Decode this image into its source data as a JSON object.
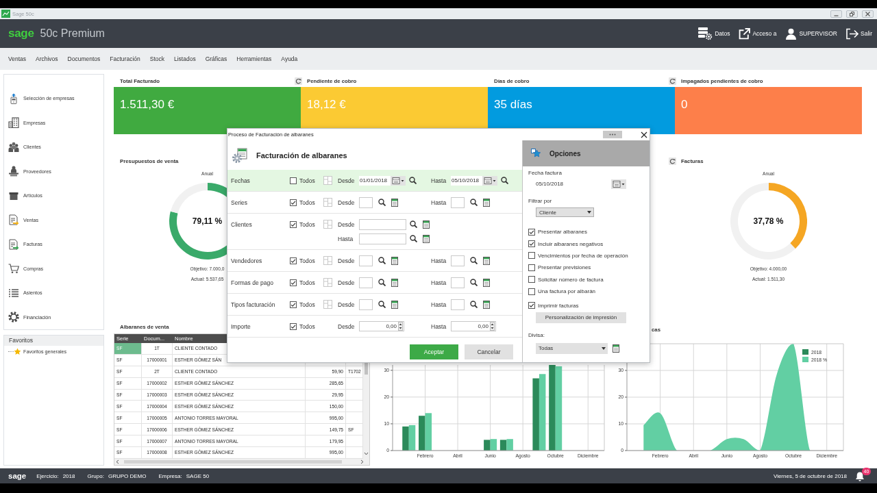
{
  "window": {
    "title": "Sage 50c"
  },
  "header": {
    "logo": "sage",
    "product": "50c Premium",
    "actions": [
      {
        "label": "Datos"
      },
      {
        "label": "Acceso a"
      },
      {
        "label": "SUPERVISOR"
      },
      {
        "label": "Salir"
      }
    ]
  },
  "menu": [
    "Ventas",
    "Archivos",
    "Documentos",
    "Facturación",
    "Stock",
    "Listados",
    "Gráficas",
    "Herramientas",
    "Ayuda"
  ],
  "sidebar": {
    "items": [
      "Selección de empresas",
      "Empresas",
      "Clientes",
      "Proveedores",
      "Artículos",
      "Ventas",
      "Facturas",
      "Compras",
      "Asientos",
      "Financiación"
    ]
  },
  "favorites": {
    "title": "Favoritos",
    "items": [
      "Favoritos generales"
    ]
  },
  "kpis": [
    {
      "title": "Total Facturado",
      "value": "1.511,30 €",
      "color": "#40aa40",
      "refresh": false
    },
    {
      "title": "Pendiente de cobro",
      "value": "18,12 €",
      "color": "#fbca33",
      "refresh": true
    },
    {
      "title": "Días de cobro",
      "value": "35 días",
      "color": "#029bdf",
      "refresh": false
    },
    {
      "title": "Impagados pendientes de cobro",
      "value": "0",
      "color": "#fd7f4a",
      "refresh": true
    }
  ],
  "gauges": [
    {
      "title": "Presupuestos de venta",
      "refresh": false,
      "period": "Anual",
      "value": "79,11 %",
      "target": "Objetivo: 7.000,0",
      "actual": "Actual: 5.537,65",
      "chart_data": {
        "type": "donut",
        "values": [
          79.11,
          20.89
        ],
        "colors": [
          "#3aaa6a",
          "#f1f1f1"
        ]
      }
    },
    {
      "title": "Facturas",
      "refresh": true,
      "period": "Anual",
      "value": "37,78 %",
      "target": "Objetivo: 4.000,00",
      "actual": "Actual: 1.511,30",
      "chart_data": {
        "type": "donut",
        "values": [
          37.78,
          62.22
        ],
        "colors": [
          "#f5a623",
          "#f1f1f1"
        ]
      }
    }
  ],
  "sales_notes": {
    "title": "Albaranes de venta",
    "columns": [
      "Serie",
      "Docum...",
      "Nombre"
    ],
    "rows": [
      {
        "selected": true,
        "cells": [
          "SF",
          "1T",
          "CLIENTE CONTADO"
        ]
      },
      {
        "selected": false,
        "cells": [
          "SF",
          "17000001",
          "ESTHER GÓMEZ SÁN"
        ]
      },
      {
        "selected": false,
        "cells": [
          "SF",
          "2T",
          "CLIENTE CONTADO",
          "59,90",
          "T1702"
        ]
      },
      {
        "selected": false,
        "cells": [
          "SF",
          "17000002",
          "ESTHER GÓMEZ SÁNCHEZ",
          "285,65"
        ]
      },
      {
        "selected": false,
        "cells": [
          "SF",
          "17000003",
          "ESTHER GÓMEZ SÁNCHEZ",
          "29,95"
        ]
      },
      {
        "selected": false,
        "cells": [
          "SF",
          "17000004",
          "ESTHER GÓMEZ SÁNCHEZ",
          "150,00"
        ]
      },
      {
        "selected": false,
        "cells": [
          "SF",
          "17000005",
          "ANTONIO TORRES MAYORAL",
          "995,00"
        ]
      },
      {
        "selected": false,
        "cells": [
          "SF",
          "17000006",
          "ESTHER GÓMEZ SÁNCHEZ",
          "149,75",
          "SF"
        ]
      },
      {
        "selected": false,
        "cells": [
          "SF",
          "17000007",
          "ANTONIO TORRES MAYORAL",
          "179,95"
        ]
      },
      {
        "selected": false,
        "cells": [
          "SF",
          "17000008",
          "ESTHER GÓMEZ SÁNCHEZ",
          "995,00"
        ]
      }
    ]
  },
  "monthly_bars": {
    "chart_data": {
      "type": "bar",
      "categories": [
        null,
        "Febrero",
        null,
        "Abril",
        null,
        "Junio",
        null,
        "Agosto",
        null,
        "Octubre",
        null,
        "Diciembre"
      ],
      "series": [
        {
          "color": "#2b8a5a",
          "values": [
            9,
            13,
            null,
            null,
            null,
            4,
            4,
            null,
            27,
            32,
            null,
            null
          ]
        },
        {
          "color": "#62cfa3",
          "values": [
            9.5,
            14,
            null,
            null,
            null,
            4.3,
            4.3,
            null,
            28.6,
            31.5,
            null,
            null
          ]
        }
      ],
      "ylim": [
        0,
        32
      ],
      "yticks": [
        0,
        10,
        20,
        30
      ],
      "grid": true
    }
  },
  "area_overview": {
    "chart_data": {
      "type": "area",
      "title": "cas",
      "categories": [
        null,
        "Febrero",
        null,
        "Abril",
        null,
        "Junio",
        null,
        "Agosto",
        null,
        "Octubre",
        null,
        "Diciembre"
      ],
      "series": [
        {
          "name": "2018",
          "color": "#2b8a5a",
          "values": [
            null,
            null,
            null,
            null,
            null,
            null,
            null,
            null,
            null,
            null,
            null,
            null
          ]
        },
        {
          "name": "2018 %",
          "color": "#62cfa3",
          "values": [
            9.5,
            14,
            0,
            0,
            0,
            4.3,
            4.3,
            0,
            28.6,
            40,
            0,
            0
          ]
        }
      ],
      "ylim": [
        0,
        40
      ],
      "yticks": [
        0,
        10,
        20,
        30
      ],
      "legend": "top-right",
      "grid": true
    }
  },
  "dialog": {
    "title": "Proceso de Facturación de albaranes",
    "heading": "Facturación de albaranes",
    "rows": [
      {
        "label": "Fechas",
        "kind": "date",
        "selected": true,
        "all": {
          "label": "Todos",
          "checked": false
        },
        "from": {
          "label": "Desde",
          "value": "01/01/2018"
        },
        "to": {
          "label": "Hasta",
          "value": "05/10/2018"
        }
      },
      {
        "label": "Series",
        "kind": "code",
        "selected": false,
        "all": {
          "label": "Todos",
          "checked": true
        },
        "from": {
          "label": "Desde"
        },
        "to": {
          "label": "Hasta"
        }
      },
      {
        "label": "Clientes",
        "kind": "stacked",
        "selected": false,
        "all": {
          "label": "Todos",
          "checked": true
        },
        "from": {
          "label": "Desde"
        },
        "to": {
          "label": "Hasta"
        }
      },
      {
        "label": "Vendedores",
        "kind": "code",
        "selected": false,
        "all": {
          "label": "Todos",
          "checked": true
        },
        "from": {
          "label": "Desde"
        },
        "to": {
          "label": "Hasta"
        }
      },
      {
        "label": "Formas de pago",
        "kind": "code",
        "selected": false,
        "all": {
          "label": "Todos",
          "checked": true
        },
        "from": {
          "label": "Desde"
        },
        "to": {
          "label": "Hasta"
        }
      },
      {
        "label": "Tipos facturación",
        "kind": "code",
        "selected": false,
        "all": {
          "label": "Todos",
          "checked": true
        },
        "from": {
          "label": "Desde"
        },
        "to": {
          "label": "Hasta"
        }
      },
      {
        "label": "Importe",
        "kind": "amount",
        "selected": false,
        "all": {
          "label": "Todos",
          "checked": true
        },
        "from": {
          "label": "Desde",
          "value": "0,00"
        },
        "to": {
          "label": "Hasta",
          "value": "0,00"
        }
      }
    ],
    "buttons": [
      {
        "label": "Aceptar",
        "kind": "primary"
      },
      {
        "label": "Cancelar",
        "kind": "secondary"
      }
    ],
    "options": {
      "title": "Opciones",
      "invoice_date": {
        "label": "Fecha factura",
        "value": "05/10/2018"
      },
      "filter": {
        "label": "Filtrar por",
        "value": "Cliente"
      },
      "checks": [
        {
          "label": "Presentar albaranes",
          "checked": true
        },
        {
          "label": "Incluir albaranes negativos",
          "checked": true
        },
        {
          "label": "Vencimientos por fecha de operación",
          "checked": false
        },
        {
          "label": "Presentar previsiones",
          "checked": false
        },
        {
          "label": "Solicitar número de factura",
          "checked": false
        },
        {
          "label": "Una factura por albarán",
          "checked": false
        }
      ],
      "print": {
        "label": "Imprimir facturas",
        "checked": true
      },
      "print_settings": "Personalización de impresión",
      "currency": {
        "label": "Divisa:",
        "value": "Todas"
      }
    }
  },
  "status_bar": {
    "logo": "sage",
    "fields": [
      {
        "label": "Ejercicio:",
        "value": "2018"
      },
      {
        "label": "Grupo:",
        "value": "GRUPO DEMO"
      },
      {
        "label": "Empresa:",
        "value": "SAGE 50"
      }
    ],
    "date": "Viernes, 5 de octubre de 2018",
    "notifications": "40"
  }
}
